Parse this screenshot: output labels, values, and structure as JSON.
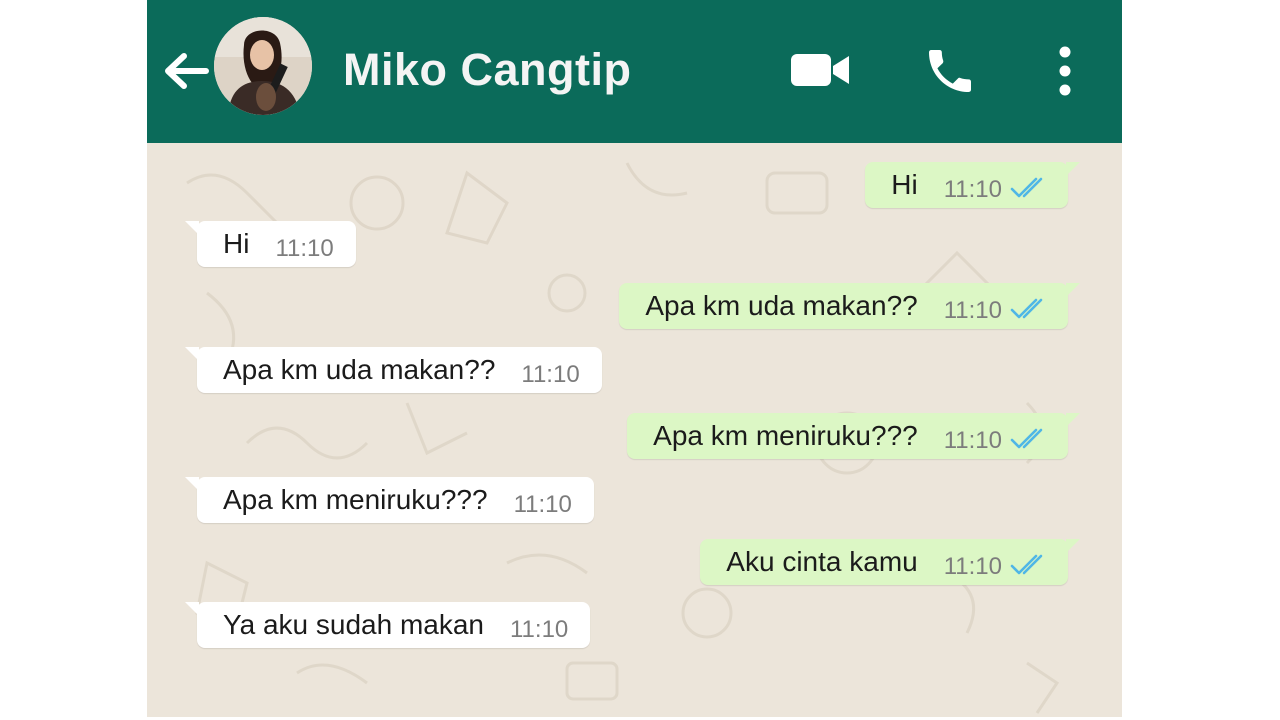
{
  "colors": {
    "header": "#0b6b5a",
    "chat_bg": "#ece5da",
    "incoming_bubble": "#ffffff",
    "outgoing_bubble": "#dcf7c5",
    "read_ticks": "#4fb6e6"
  },
  "header": {
    "contact_name": "Miko Cangtip",
    "icons": [
      "back-arrow-icon",
      "avatar",
      "video-call-icon",
      "phone-icon",
      "more-vert-icon"
    ]
  },
  "messages": [
    {
      "direction": "out",
      "text": "Hi",
      "time": "11:10",
      "status": "read"
    },
    {
      "direction": "in",
      "text": "Hi",
      "time": "11:10"
    },
    {
      "direction": "out",
      "text": "Apa km uda makan??",
      "time": "11:10",
      "status": "read"
    },
    {
      "direction": "in",
      "text": "Apa km uda makan??",
      "time": "11:10"
    },
    {
      "direction": "out",
      "text": "Apa km meniruku???",
      "time": "11:10",
      "status": "read"
    },
    {
      "direction": "in",
      "text": "Apa km meniruku???",
      "time": "11:10"
    },
    {
      "direction": "out",
      "text": "Aku cinta kamu",
      "time": "11:10",
      "status": "read"
    },
    {
      "direction": "in",
      "text": "Ya aku sudah makan",
      "time": "11:10"
    }
  ]
}
